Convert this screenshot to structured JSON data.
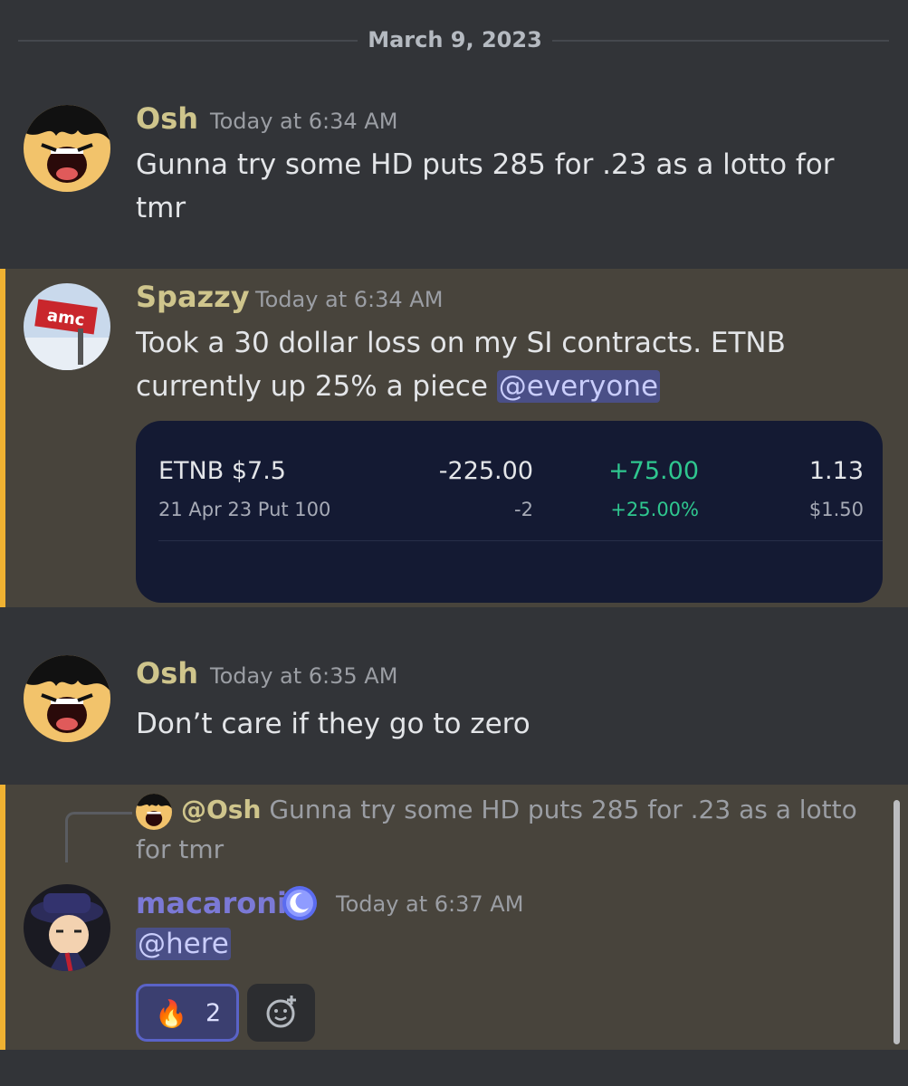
{
  "date_divider": "March 9, 2023",
  "messages": [
    {
      "author": "Osh",
      "author_color": "#cfc58c",
      "time": "Today at 6:34 AM",
      "text": "Gunna try some HD puts 285 for .23 as a lotto for tmr",
      "avatar_icon": "luffy-laughing-avatar"
    },
    {
      "author": "Spazzy",
      "author_color": "#cfc58c",
      "time": "Today at 6:34 AM",
      "text": "Took a 30 dollar loss on my SI contracts. ETNB currently up 25% a piece ",
      "mention": "@everyone",
      "avatar_icon": "amc-sign-avatar",
      "embed": {
        "symbol": "ETNB $7.5",
        "contract": "21 Apr 23  Put 100",
        "market_value": "-225.00",
        "quantity": "-2",
        "pl": "+75.00",
        "pl_pct": "+25.00%",
        "price": "1.13",
        "cost": "$1.50",
        "positive_color": "#2fc78f"
      }
    },
    {
      "author": "Osh",
      "author_color": "#cfc58c",
      "time": "Today at 6:35 AM",
      "text": "Don’t care if they go to zero",
      "avatar_icon": "luffy-laughing-avatar"
    },
    {
      "reply": {
        "author": "@Osh",
        "text": "Gunna try some HD puts 285 for .23 as a lotto for tmr"
      },
      "author": "macaroni",
      "author_color": "#7b79d6",
      "badge_icon": "moon-badge-icon",
      "time": "Today at 6:37 AM",
      "mention": "@here",
      "avatar_icon": "anime-kid-hat-avatar",
      "reactions": [
        {
          "emoji": "🔥",
          "count": "2"
        }
      ],
      "add_reaction_icon": "add-reaction-icon"
    }
  ],
  "highlight_color": "#f0b232"
}
